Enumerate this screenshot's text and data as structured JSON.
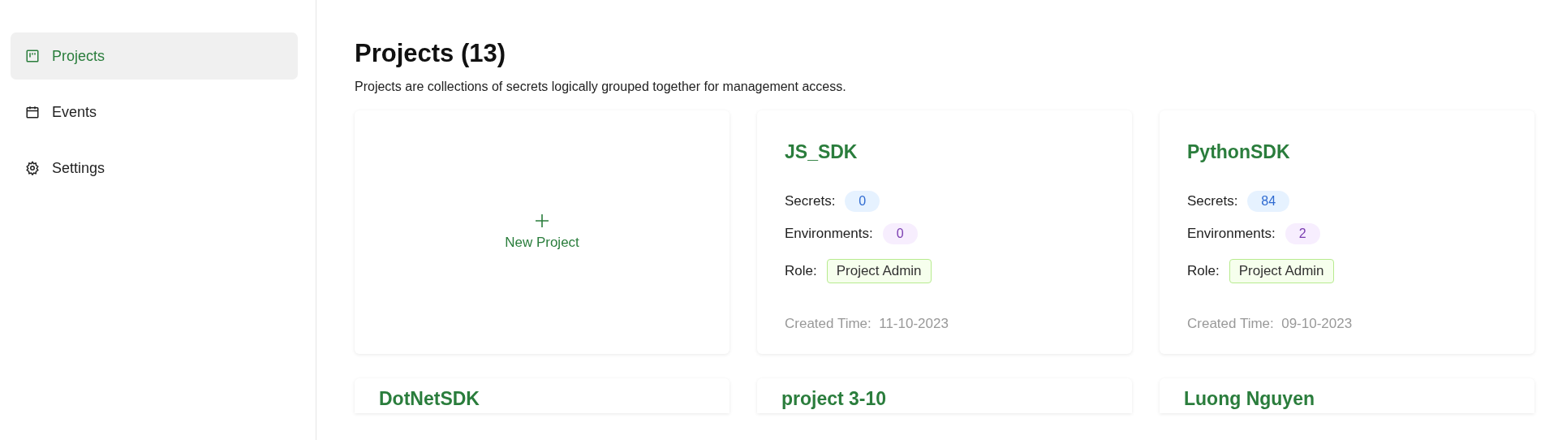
{
  "sidebar": {
    "items": [
      {
        "label": "Projects",
        "kind": "board",
        "selected": true
      },
      {
        "label": "Events",
        "kind": "calendar",
        "selected": false
      },
      {
        "label": "Settings",
        "kind": "gear",
        "selected": false
      }
    ]
  },
  "page": {
    "title": "Projects (13)",
    "description": "Projects are collections of secrets logically grouped together for management access."
  },
  "new_project": {
    "label": "New Project"
  },
  "projects": [
    {
      "name": "JS_SDK",
      "secrets_label": "Secrets:",
      "secrets": "0",
      "environments_label": "Environments:",
      "environments": "0",
      "role_label": "Role:",
      "role": "Project Admin",
      "created_label": "Created Time:",
      "created": "11-10-2023"
    },
    {
      "name": "PythonSDK",
      "secrets_label": "Secrets:",
      "secrets": "84",
      "environments_label": "Environments:",
      "environments": "2",
      "role_label": "Role:",
      "role": "Project Admin",
      "created_label": "Created Time:",
      "created": "09-10-2023"
    },
    {
      "name": "DotNetSDK"
    },
    {
      "name": "project 3-10"
    },
    {
      "name": "Luong Nguyen"
    }
  ]
}
